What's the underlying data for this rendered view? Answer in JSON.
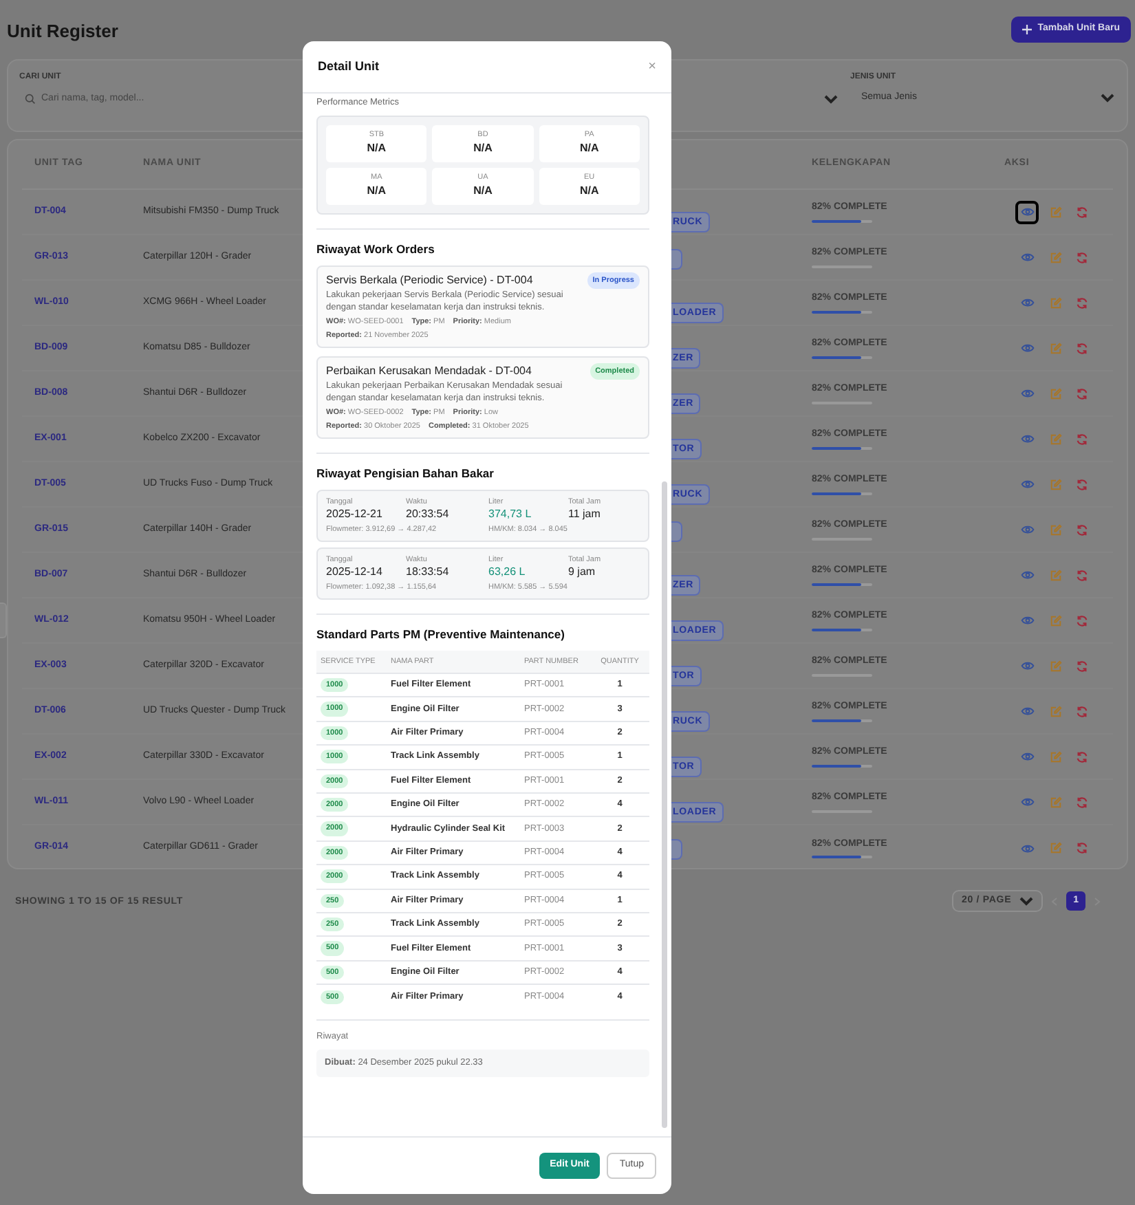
{
  "page": {
    "title": "Unit Register",
    "add_button": "Tambah Unit Baru"
  },
  "filters": {
    "search_label": "CARI UNIT",
    "search_placeholder": "Cari nama, tag, model...",
    "type_label": "JENIS UNIT",
    "type_value": "Semua Jenis"
  },
  "table": {
    "columns": [
      "UNIT TAG",
      "NAMA UNIT",
      "KELENGKAPAN",
      "AKSI"
    ],
    "rows": [
      {
        "tag": "DT-004",
        "name": "Mitsubishi FM350 - Dump Truck",
        "badge_text": "RUCK",
        "completeness": "82% COMPLETE",
        "level": 0.82,
        "focused": true
      },
      {
        "tag": "GR-013",
        "name": "Caterpillar 120H - Grader",
        "completeness": "82% COMPLETE",
        "level": 0,
        "focused": false
      },
      {
        "tag": "WL-010",
        "name": "XCMG 966H - Wheel Loader",
        "badge_text": "LOADER",
        "completeness": "82% COMPLETE",
        "level": 0.82,
        "focused": false
      },
      {
        "tag": "BD-009",
        "name": "Komatsu D85 - Bulldozer",
        "badge_text": "ZER",
        "completeness": "82% COMPLETE",
        "level": 0.82,
        "focused": false
      },
      {
        "tag": "BD-008",
        "name": "Shantui D6R - Bulldozer",
        "badge_text": "ZER",
        "completeness": "82% COMPLETE",
        "level": 0,
        "focused": false
      },
      {
        "tag": "EX-001",
        "name": "Kobelco ZX200 - Excavator",
        "badge_text": "TOR",
        "completeness": "82% COMPLETE",
        "level": 0.82,
        "focused": false
      },
      {
        "tag": "DT-005",
        "name": "UD Trucks Fuso - Dump Truck",
        "badge_text": "RUCK",
        "completeness": "82% COMPLETE",
        "level": 0.82,
        "focused": false
      },
      {
        "tag": "GR-015",
        "name": "Caterpillar 140H - Grader",
        "completeness": "82% COMPLETE",
        "level": 0,
        "focused": false
      },
      {
        "tag": "BD-007",
        "name": "Shantui D6R - Bulldozer",
        "badge_text": "ZER",
        "completeness": "82% COMPLETE",
        "level": 0.82,
        "focused": false
      },
      {
        "tag": "WL-012",
        "name": "Komatsu 950H - Wheel Loader",
        "badge_text": "LOADER",
        "completeness": "82% COMPLETE",
        "level": 0.82,
        "focused": false
      },
      {
        "tag": "EX-003",
        "name": "Caterpillar 320D - Excavator",
        "badge_text": "TOR",
        "completeness": "82% COMPLETE",
        "level": 0,
        "focused": false
      },
      {
        "tag": "DT-006",
        "name": "UD Trucks Quester - Dump Truck",
        "badge_text": "RUCK",
        "completeness": "82% COMPLETE",
        "level": 0.82,
        "focused": false
      },
      {
        "tag": "EX-002",
        "name": "Caterpillar 330D - Excavator",
        "badge_text": "TOR",
        "completeness": "82% COMPLETE",
        "level": 0.82,
        "focused": false
      },
      {
        "tag": "WL-011",
        "name": "Volvo L90 - Wheel Loader",
        "badge_text": "LOADER",
        "completeness": "82% COMPLETE",
        "level": 0,
        "focused": false
      },
      {
        "tag": "GR-014",
        "name": "Caterpillar GD611 - Grader",
        "completeness": "82% COMPLETE",
        "level": 0.82,
        "focused": false
      }
    ]
  },
  "pagination": {
    "summary": "SHOWING 1 TO 15 OF 15 RESULT",
    "page_size": "20 / PAGE",
    "pages": [
      {
        "label": "1",
        "selected": true
      }
    ]
  },
  "modal": {
    "title": "Detail Unit",
    "close": "×",
    "metrics_label": "Performance Metrics",
    "metrics": [
      {
        "label": "STB",
        "value": "N/A"
      },
      {
        "label": "BD",
        "value": "N/A"
      },
      {
        "label": "PA",
        "value": "N/A"
      },
      {
        "label": "MA",
        "value": "N/A"
      },
      {
        "label": "UA",
        "value": "N/A"
      },
      {
        "label": "EU",
        "value": "N/A"
      }
    ],
    "work_orders_title": "Riwayat Work Orders",
    "work_orders": [
      {
        "title": "Servis Berkala (Periodic Service) - DT-004",
        "status": "In Progress",
        "kind": "in_progress",
        "description": "Lakukan pekerjaan Servis Berkala (Periodic Service) sesuai dengan standar keselamatan kerja dan instruksi teknis.",
        "meta": [
          "**WO#:** WO-SEED-0001",
          "**Type:** PM",
          "**Priority:** Medium"
        ],
        "dates": [
          "**Reported:** 21 November 2025"
        ]
      },
      {
        "title": "Perbaikan Kerusakan Mendadak - DT-004",
        "status": "Completed",
        "kind": "completed",
        "description": "Lakukan pekerjaan Perbaikan Kerusakan Mendadak sesuai dengan standar keselamatan kerja dan instruksi teknis.",
        "meta": [
          "**WO#:** WO-SEED-0002",
          "**Type:** PM",
          "**Priority:** Low"
        ],
        "dates": [
          "**Reported:** 30 Oktober 2025",
          "**Completed:** 31 Oktober 2025"
        ]
      }
    ],
    "fuel_title": "Riwayat Pengisian Bahan Bakar",
    "fuel": [
      {
        "fields": [
          {
            "label": "Tanggal",
            "value": "2025-12-21"
          },
          {
            "label": "Waktu",
            "value": "20:33:54"
          },
          {
            "label": "Liter",
            "value": "374,73 L",
            "kind": "liter"
          },
          {
            "label": "Total Jam",
            "value": "11 jam"
          }
        ],
        "flowmeter": "Flowmeter: 3.912,69 → 4.287,42",
        "hmkm": "HM/KM: 8.034 → 8.045"
      },
      {
        "fields": [
          {
            "label": "Tanggal",
            "value": "2025-12-14"
          },
          {
            "label": "Waktu",
            "value": "18:33:54"
          },
          {
            "label": "Liter",
            "value": "63,26 L",
            "kind": "liter"
          },
          {
            "label": "Total Jam",
            "value": "9 jam"
          }
        ],
        "flowmeter": "Flowmeter: 1.092,38 → 1.155,64",
        "hmkm": "HM/KM: 5.585 → 5.594"
      }
    ],
    "parts_title": "Standard Parts PM (Preventive Maintenance)",
    "parts_columns": [
      "SERVICE TYPE",
      "NAMA PART",
      "PART NUMBER",
      "QUANTITY"
    ],
    "parts": [
      [
        "1000",
        "Fuel Filter Element",
        "PRT-0001",
        "1"
      ],
      [
        "1000",
        "Engine Oil Filter",
        "PRT-0002",
        "3"
      ],
      [
        "1000",
        "Air Filter Primary",
        "PRT-0004",
        "2"
      ],
      [
        "1000",
        "Track Link Assembly",
        "PRT-0005",
        "1"
      ],
      [
        "2000",
        "Fuel Filter Element",
        "PRT-0001",
        "2"
      ],
      [
        "2000",
        "Engine Oil Filter",
        "PRT-0002",
        "4"
      ],
      [
        "2000",
        "Hydraulic Cylinder Seal Kit",
        "PRT-0003",
        "2"
      ],
      [
        "2000",
        "Air Filter Primary",
        "PRT-0004",
        "4"
      ],
      [
        "2000",
        "Track Link Assembly",
        "PRT-0005",
        "4"
      ],
      [
        "250",
        "Air Filter Primary",
        "PRT-0004",
        "1"
      ],
      [
        "250",
        "Track Link Assembly",
        "PRT-0005",
        "2"
      ],
      [
        "500",
        "Fuel Filter Element",
        "PRT-0001",
        "3"
      ],
      [
        "500",
        "Engine Oil Filter",
        "PRT-0002",
        "4"
      ],
      [
        "500",
        "Air Filter Primary",
        "PRT-0004",
        "4"
      ]
    ],
    "history_label": "Riwayat",
    "created": "**Dibuat:** 24 Desember 2025 pukul 22.33",
    "buttons": [
      {
        "label": "Edit Unit",
        "kind": "primary"
      },
      {
        "label": "Tutup",
        "kind": "secondary"
      }
    ]
  }
}
